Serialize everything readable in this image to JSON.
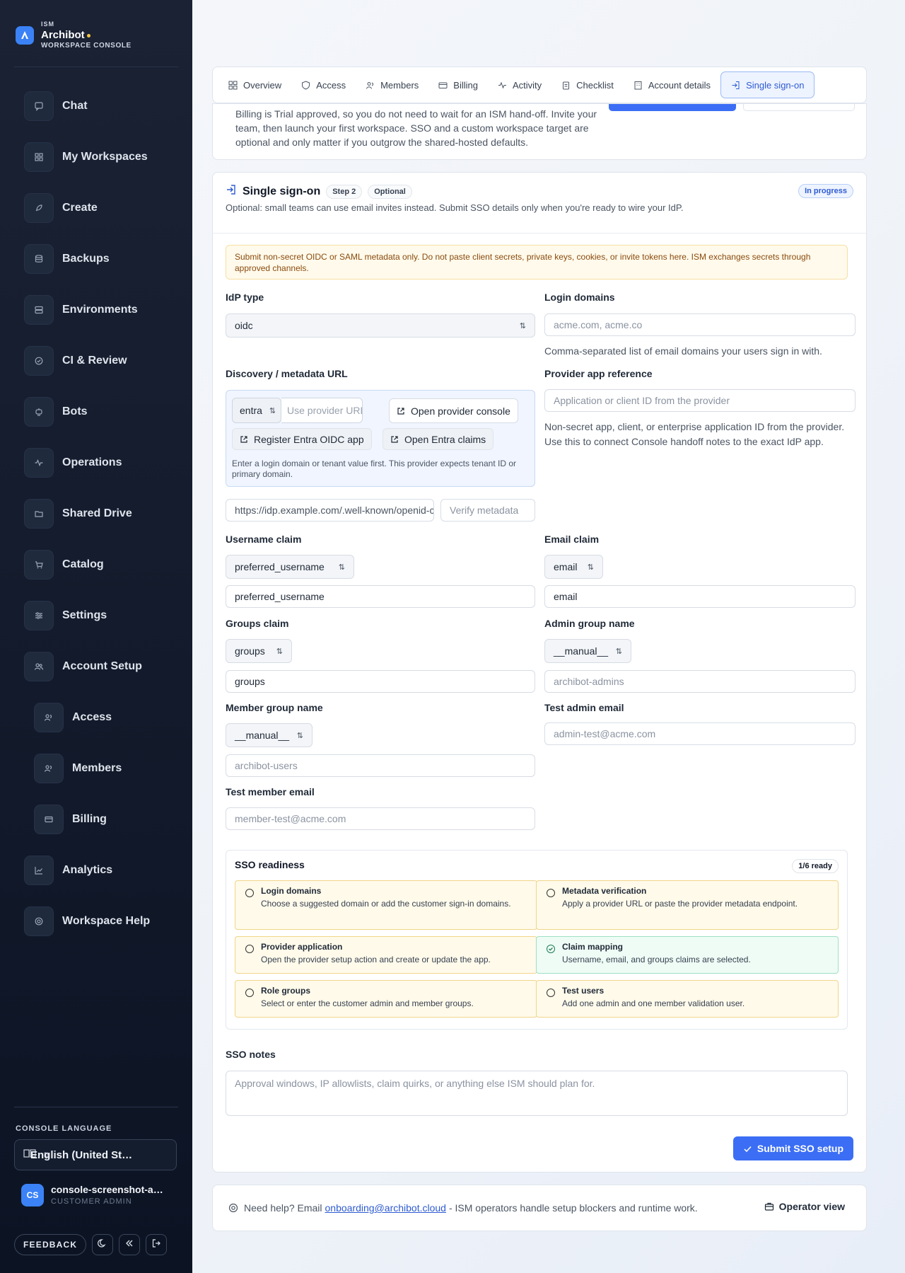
{
  "brand": {
    "small": "ISM",
    "name": "Archibot",
    "sub": "WORKSPACE CONSOLE"
  },
  "sidebar": {
    "items": [
      {
        "label": "Chat"
      },
      {
        "label": "My Workspaces"
      },
      {
        "label": "Create"
      },
      {
        "label": "Backups"
      },
      {
        "label": "Environments"
      },
      {
        "label": "CI & Review"
      },
      {
        "label": "Bots"
      },
      {
        "label": "Operations"
      },
      {
        "label": "Shared Drive"
      },
      {
        "label": "Catalog"
      },
      {
        "label": "Settings"
      },
      {
        "label": "Account Setup"
      },
      {
        "label": "Access"
      },
      {
        "label": "Members"
      },
      {
        "label": "Billing"
      },
      {
        "label": "Analytics"
      },
      {
        "label": "Workspace Help"
      }
    ],
    "language_title": "CONSOLE LANGUAGE",
    "language_value": "English (United States)",
    "user_initials": "CS",
    "user_name": "console-screenshot-admin",
    "user_role": "CUSTOMER ADMIN",
    "feedback_label": "FEEDBACK"
  },
  "tabs": [
    {
      "label": "Overview"
    },
    {
      "label": "Access"
    },
    {
      "label": "Members"
    },
    {
      "label": "Billing"
    },
    {
      "label": "Activity"
    },
    {
      "label": "Checklist"
    },
    {
      "label": "Account details"
    },
    {
      "label": "Single sign-on"
    }
  ],
  "top_card": {
    "text": "Billing is Trial approved, so you do not need to wait for an ISM hand-off. Invite your team, then launch your first workspace. SSO and a custom workspace target are optional and only matter if you outgrow the shared-hosted defaults."
  },
  "sso": {
    "title": "Single sign-on",
    "step": "Step 2",
    "optional": "Optional",
    "status": "In progress",
    "desc": "Optional: small teams can use email invites instead. Submit SSO details only when you're ready to wire your IdP.",
    "warning": "Submit non-secret OIDC or SAML metadata only. Do not paste client secrets, private keys, cookies, or invite tokens here. ISM exchanges secrets through approved channels.",
    "idp_type_label": "IdP type",
    "idp_type_value": "oidc",
    "login_domains_label": "Login domains",
    "login_domains_placeholder": "acme.com, acme.co",
    "login_domains_help": "Comma-separated list of email domains your users sign in with.",
    "discovery_label": "Discovery / metadata URL",
    "provider_value": "entra",
    "provider_url_placeholder": "Use provider URL",
    "open_console_label": "Open provider console",
    "register_app_label": "Register Entra OIDC app",
    "open_claims_label": "Open Entra claims",
    "discovery_hint": "Enter a login domain or tenant value first. This provider expects tenant ID or primary domain.",
    "metadata_url_value": "https://idp.example.com/.well-known/openid-configuration",
    "verify_label": "Verify metadata",
    "provider_ref_label": "Provider app reference",
    "provider_ref_placeholder": "Application or client ID from the provider",
    "provider_ref_help": "Non-secret app, client, or enterprise application ID from the provider. Use this to connect Console handoff notes to the exact IdP app.",
    "username_claim_label": "Username claim",
    "username_claim_select": "preferred_username",
    "username_claim_value": "preferred_username",
    "email_claim_label": "Email claim",
    "email_claim_select": "email",
    "email_claim_value": "email",
    "groups_claim_label": "Groups claim",
    "groups_claim_select": "groups",
    "groups_claim_value": "groups",
    "admin_group_label": "Admin group name",
    "admin_group_select": "__manual__",
    "admin_group_placeholder": "archibot-admins",
    "member_group_label": "Member group name",
    "member_group_select": "__manual__",
    "member_group_placeholder": "archibot-users",
    "test_admin_label": "Test admin email",
    "test_admin_placeholder": "admin-test@acme.com",
    "test_member_label": "Test member email",
    "test_member_placeholder": "member-test@acme.com",
    "readiness_title": "SSO readiness",
    "readiness_badge": "1/6 ready",
    "readiness": [
      {
        "title": "Login domains",
        "desc": "Choose a suggested domain or add the customer sign-in domains."
      },
      {
        "title": "Metadata verification",
        "desc": "Apply a provider URL or paste the provider metadata endpoint."
      },
      {
        "title": "Provider application",
        "desc": "Open the provider setup action and create or update the app."
      },
      {
        "title": "Claim mapping",
        "desc": "Username, email, and groups claims are selected."
      },
      {
        "title": "Role groups",
        "desc": "Select or enter the customer admin and member groups."
      },
      {
        "title": "Test users",
        "desc": "Add one admin and one member validation user."
      }
    ],
    "notes_label": "SSO notes",
    "notes_placeholder": "Approval windows, IP allowlists, claim quirks, or anything else ISM should plan for.",
    "submit_label": "Submit SSO setup"
  },
  "helpbar": {
    "prefix": "Need help? Email",
    "email": "onboarding@archibot.cloud",
    "suffix": "- ISM operators handle setup blockers and runtime work.",
    "operator_label": "Operator view"
  },
  "colors": {
    "accent": "#3b6ef5",
    "sidebar": "#121a2b",
    "warning_bg": "#fffaeb",
    "success_bg": "#eefcf5"
  }
}
